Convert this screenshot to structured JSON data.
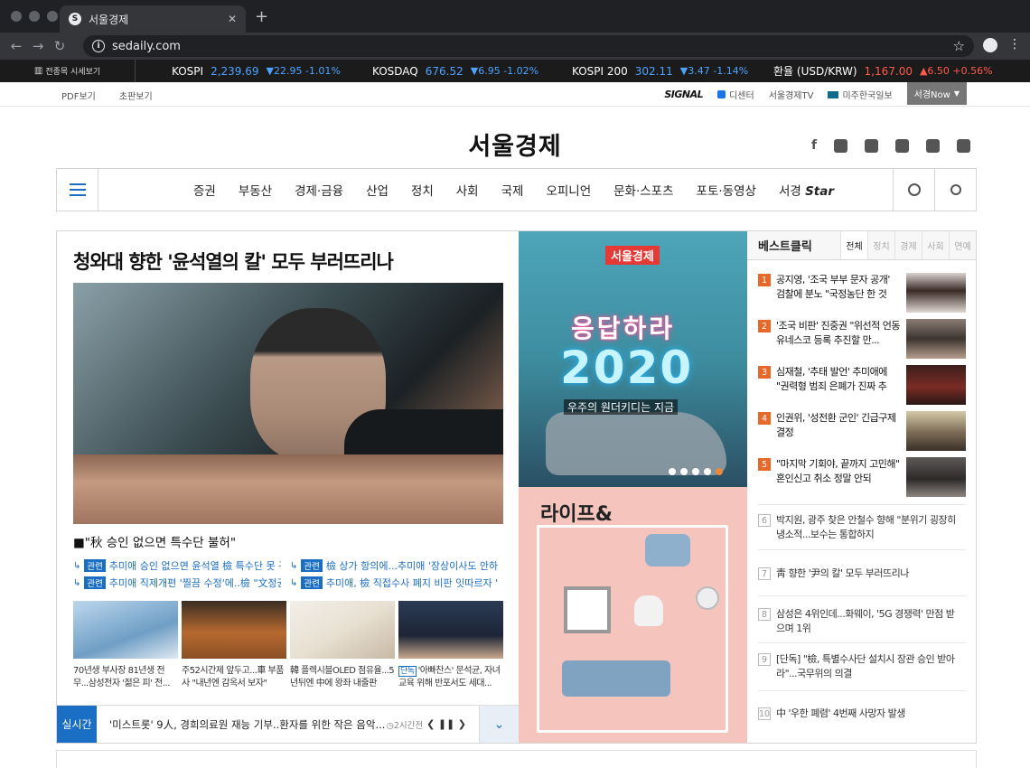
{
  "browser": {
    "tab_title": "서울경제",
    "url": "sedaily.com",
    "favicon": "S"
  },
  "ticker": {
    "label": "전종목 시세보기",
    "items": [
      {
        "name": "KOSPI",
        "value": "2,239.69",
        "change": "▼22.95 -1.01%",
        "color": "blue"
      },
      {
        "name": "KOSDAQ",
        "value": "676.52",
        "change": "▼6.95 -1.02%",
        "color": "blue"
      },
      {
        "name": "KOSPI 200",
        "value": "302.11",
        "change": "▼3.47 -1.14%",
        "color": "blue"
      },
      {
        "name": "환율 (USD/KRW)",
        "value": "1,167.00",
        "change": "▲6.50 +0.56%",
        "color": "red"
      }
    ]
  },
  "util": {
    "pdf": "PDF보기",
    "chopan": "초판보기",
    "signal": "SIGNAL",
    "decenter": "디센터",
    "tv": "서울경제TV",
    "mijoo": "미주한국일보",
    "snow": "서경Now"
  },
  "logo": "서울경제",
  "nav": [
    "증권",
    "부동산",
    "경제·금융",
    "산업",
    "정치",
    "사회",
    "국제",
    "오피니언",
    "문화·스포츠",
    "포토·동영상"
  ],
  "nav_last": "서경",
  "nav_last_logo": "Star",
  "lead": {
    "headline": "청와대 향한 '윤석열의 칼' 모두 부러뜨리나",
    "caption": "■\"秋 승인 없으면 특수단 불허\"",
    "related_tag": "관련",
    "related": [
      "추미애 승인 없으면 윤석열 檢 특수단 못 꾸린다",
      "檢 상가 항의에...추미애 '장상이사도 안하는...",
      "추미애 직제개편 '찔끔 수정'에..檢 \"文정권 수사...",
      "추미애, 檢 직접수사 폐지 비판 잇따르자 '일보후..."
    ],
    "thumbs": [
      {
        "text": "70년생 부사장 81년생 전무...삼성전자 '젊은 피' 전..."
      },
      {
        "text": "주52시간제 앞두고...車 부품사 \"내년엔 감옥서 보자\""
      },
      {
        "text": "韓 플렉시블OLED 점유율...5년뒤엔 中에 왕좌 내줄판"
      },
      {
        "tag": "단독",
        "text": "'아빠찬스' 문석균, 자녀 교육 위해 반포서도 세대..."
      }
    ]
  },
  "live": {
    "label": "실시간",
    "text": "'미스트롯' 9人, 경희의료원 재능 기부..환자를 위한 작은 음악...",
    "time": "2시간전",
    "controls": "❮ ❚❚ ❯"
  },
  "promo": {
    "brand": "서울경제",
    "title1": "응답하라",
    "title2": "2020",
    "subtitle": "우주의 원더키디는 지금"
  },
  "life": {
    "title": "라이프&"
  },
  "best": {
    "title": "베스트클릭",
    "tabs": [
      "전체",
      "정치",
      "경제",
      "사회",
      "연예"
    ],
    "items": [
      {
        "no": "1",
        "text": "공지영, '조국 부부 문자 공개' 검찰에 분노 \"국정농단 한 것"
      },
      {
        "no": "2",
        "text": "'조국 비판' 진중권 \"위선적 언동 유네스코 등록 추진할 만..."
      },
      {
        "no": "3",
        "text": "심재철, '추태 발언' 추미애에 \"권력형 범죄 은폐가 진짜 추"
      },
      {
        "no": "4",
        "text": "인권위, '성전환 군인' 긴급구제 결정"
      },
      {
        "no": "5",
        "text": "\"마지막 기회야, 끝까지 고민해\" 혼인신고 취소 정말 안되"
      },
      {
        "no": "6",
        "text": "박지원, 광주 찾은 안철수 향해 \"분위기 굉장히 냉소적...보수는 통합하지"
      },
      {
        "no": "7",
        "text": "靑 향한 '尹의 칼' 모두 부러뜨리나"
      },
      {
        "no": "8",
        "text": "삼성은 4위인데...화웨이, '5G 경쟁력' 만점 받으며 1위"
      },
      {
        "no": "9",
        "text": "[단독] \"檢, 특별수사단 설치시 장관 승인 받아라\"...국무위의 의결"
      },
      {
        "no": "10",
        "text": "中 '우한 폐렴' 4번째 사망자 발생"
      }
    ]
  }
}
